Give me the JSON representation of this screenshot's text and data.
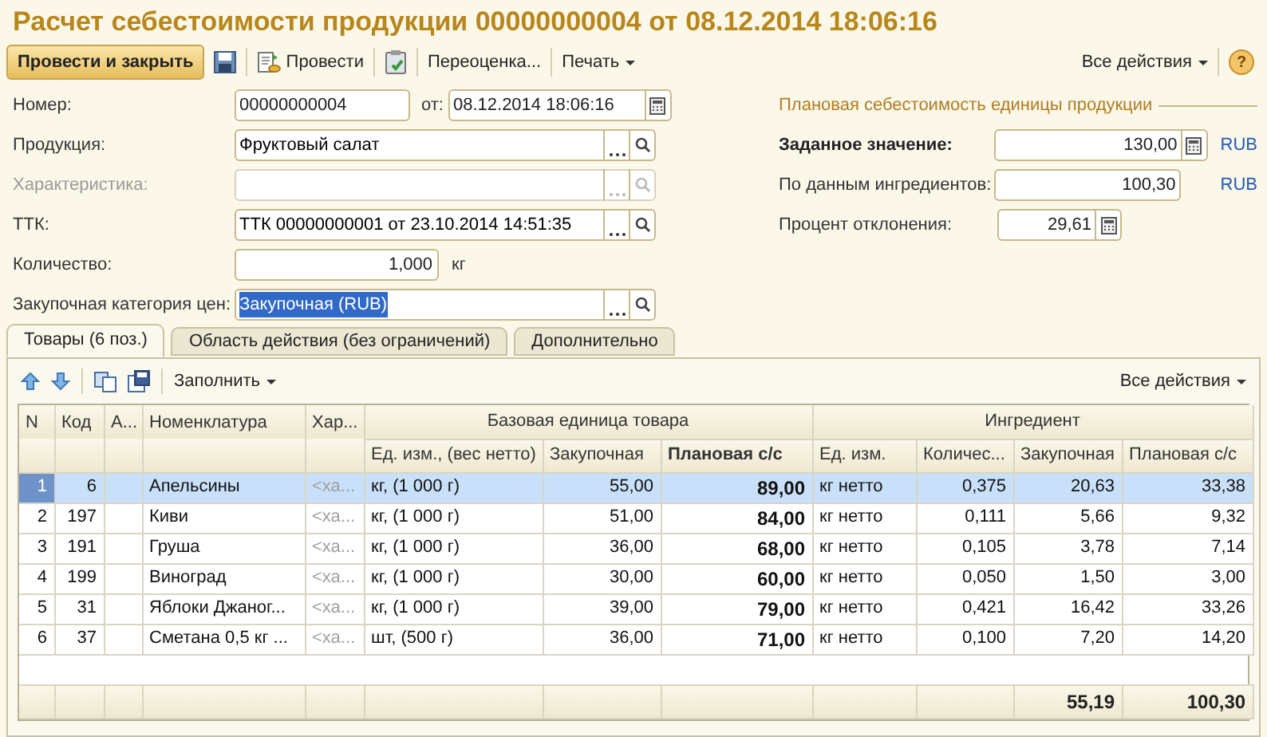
{
  "window": {
    "title": "Расчет себестоимости продукции 00000000004 от 08.12.2014 18:06:16"
  },
  "toolbar": {
    "post_close": "Провести и закрыть",
    "post": "Провести",
    "revalue": "Переоценка...",
    "print": "Печать",
    "all_actions": "Все действия",
    "help": "?"
  },
  "form": {
    "rows": [
      {
        "kind": "number",
        "label": "Номер:",
        "value": "00000000004",
        "date_label": "от:",
        "date_value": "08.12.2014 18:06:16"
      },
      {
        "kind": "ref",
        "label": "Продукция:",
        "value": "Фруктовый салат",
        "disabled": false,
        "highlighted": false
      },
      {
        "kind": "ref",
        "label": "Характеристика:",
        "disabled": true
      },
      {
        "kind": "ref",
        "label": "ТТК:",
        "value": "ТТК 00000000001 от 23.10.2014 14:51:35",
        "disabled": false,
        "highlighted": false
      },
      {
        "kind": "quantity",
        "label": "Количество:",
        "value": "1,000",
        "unit": "кг"
      },
      {
        "kind": "ref",
        "label": "Закупочная категория цен:",
        "value": "Закупочная (RUB)",
        "disabled": false,
        "highlighted": true
      }
    ]
  },
  "cost_panel": {
    "title": "Плановая себестоимость единицы продукции",
    "rows": [
      {
        "label": "Заданное значение:",
        "value": "130,00",
        "bold": true,
        "calculator": true,
        "currency": "RUB"
      },
      {
        "label": "По данным ингредиентов:",
        "value": "100,30",
        "bold": false,
        "calculator": false,
        "currency": "RUB"
      },
      {
        "label": "Процент отклонения:",
        "value": "29,61",
        "bold": false,
        "calculator": true
      }
    ]
  },
  "tabs": [
    {
      "label": "Товары (6 поз.)",
      "selected": true
    },
    {
      "label": "Область действия (без ограничений)",
      "selected": false
    },
    {
      "label": "Дополнительно",
      "selected": false
    }
  ],
  "table_toolbar": {
    "fill": "Заполнить",
    "all_actions": "Все действия"
  },
  "table": {
    "fixed_columns": [
      "N",
      "Код",
      "А...",
      "Номенклатура",
      "Хар..."
    ],
    "groups": [
      {
        "label": "Базовая единица товара",
        "columns": [
          {
            "label": "Ед. изм., (вес нетто)",
            "bold": false
          },
          {
            "label": "Закупочная",
            "bold": false
          },
          {
            "label": "Плановая с/с",
            "bold": true
          }
        ]
      },
      {
        "label": "Ингредиент",
        "columns": [
          {
            "label": "Ед. изм.",
            "bold": false
          },
          {
            "label": "Количес...",
            "bold": false
          },
          {
            "label": "Закупочная",
            "bold": false
          },
          {
            "label": "Плановая с/с",
            "bold": false
          }
        ]
      }
    ],
    "rows": [
      {
        "selected": true,
        "n": "1",
        "code": "6",
        "name": "Апельсины",
        "characteristic": "<ха...",
        "unit": "кг, (1 000 г)",
        "purchase": "55,00",
        "planned": "89,00",
        "ing_unit": "кг нетто",
        "qty": "0,375",
        "ing_purchase": "20,63",
        "ing_planned": "33,38"
      },
      {
        "selected": false,
        "n": "2",
        "code": "197",
        "name": "Киви",
        "characteristic": "<ха...",
        "unit": "кг, (1 000 г)",
        "purchase": "51,00",
        "planned": "84,00",
        "ing_unit": "кг нетто",
        "qty": "0,111",
        "ing_purchase": "5,66",
        "ing_planned": "9,32"
      },
      {
        "selected": false,
        "n": "3",
        "code": "191",
        "name": "Груша",
        "characteristic": "<ха...",
        "unit": "кг, (1 000 г)",
        "purchase": "36,00",
        "planned": "68,00",
        "ing_unit": "кг нетто",
        "qty": "0,105",
        "ing_purchase": "3,78",
        "ing_planned": "7,14"
      },
      {
        "selected": false,
        "n": "4",
        "code": "199",
        "name": "Виноград",
        "characteristic": "<ха...",
        "unit": "кг, (1 000 г)",
        "purchase": "30,00",
        "planned": "60,00",
        "ing_unit": "кг нетто",
        "qty": "0,050",
        "ing_purchase": "1,50",
        "ing_planned": "3,00"
      },
      {
        "selected": false,
        "n": "5",
        "code": "31",
        "name": "Яблоки Джаног...",
        "characteristic": "<ха...",
        "unit": "кг, (1 000 г)",
        "purchase": "39,00",
        "planned": "79,00",
        "ing_unit": "кг нетто",
        "qty": "0,421",
        "ing_purchase": "16,42",
        "ing_planned": "33,26"
      },
      {
        "selected": false,
        "n": "6",
        "code": "37",
        "name": "Сметана 0,5 кг ...",
        "characteristic": "<ха...",
        "unit": "шт, (500 г)",
        "purchase": "36,00",
        "planned": "71,00",
        "ing_unit": "кг нетто",
        "qty": "0,100",
        "ing_purchase": "7,20",
        "ing_planned": "14,20"
      }
    ],
    "footer": {
      "ing_purchase": "55,19",
      "ing_planned": "100,30"
    }
  }
}
